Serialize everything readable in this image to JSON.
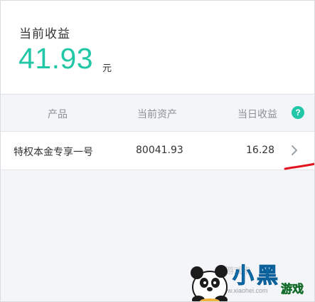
{
  "summary": {
    "label": "当前收益",
    "value": "41.93",
    "unit": "元"
  },
  "table": {
    "headers": {
      "product": "产品",
      "current_assets": "当前资产",
      "daily_earnings": "当日收益"
    },
    "help_icon_text": "?",
    "rows": [
      {
        "name": "特权本金专享一号",
        "current_assets": "80041.93",
        "daily_earnings": "16.28"
      }
    ]
  },
  "watermark": {
    "logo_text": "小黑游戏",
    "faint_text": "游戏卡",
    "url": "www.xiaohei.com"
  },
  "colors": {
    "accent": "#22c7a8",
    "annotation": "#e0141e"
  },
  "icons": {
    "help": "question-circle-icon",
    "row_action": "chevron-right-icon"
  }
}
